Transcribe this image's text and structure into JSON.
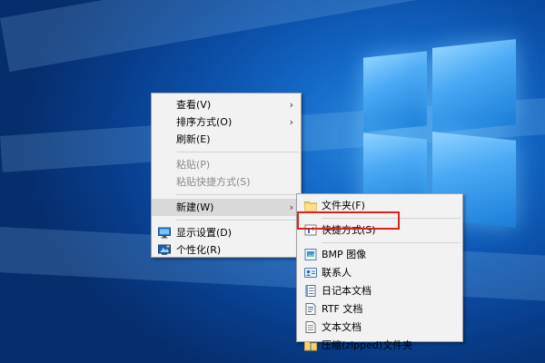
{
  "desktop": {
    "background": "Windows 10 hero wallpaper"
  },
  "context_menu": {
    "items": [
      {
        "label": "查看(V)",
        "submenu": true,
        "enabled": true
      },
      {
        "label": "排序方式(O)",
        "submenu": true,
        "enabled": true
      },
      {
        "label": "刷新(E)",
        "submenu": false,
        "enabled": true
      },
      {
        "label": "粘贴(P)",
        "submenu": false,
        "enabled": false
      },
      {
        "label": "粘贴快捷方式(S)",
        "submenu": false,
        "enabled": false
      },
      {
        "label": "新建(W)",
        "submenu": true,
        "enabled": true,
        "highlighted": true
      },
      {
        "label": "显示设置(D)",
        "icon": "display-settings-icon",
        "enabled": true
      },
      {
        "label": "个性化(R)",
        "icon": "personalize-icon",
        "enabled": true
      }
    ],
    "arrow_glyph": "›"
  },
  "new_submenu": {
    "items": [
      {
        "label": "文件夹(F)",
        "icon": "folder-icon"
      },
      {
        "label": "快捷方式(S)",
        "icon": "shortcut-icon",
        "outlined": true
      },
      {
        "label": "BMP 图像",
        "icon": "bmp-image-icon"
      },
      {
        "label": "联系人",
        "icon": "contact-icon"
      },
      {
        "label": "日记本文档",
        "icon": "journal-document-icon"
      },
      {
        "label": "RTF 文档",
        "icon": "rtf-document-icon"
      },
      {
        "label": "文本文档",
        "icon": "text-document-icon"
      },
      {
        "label": "压缩(zipped)文件夹",
        "icon": "zip-folder-icon"
      }
    ]
  },
  "colors": {
    "highlight_outline": "#e02020",
    "menu_background": "#f2f2f2",
    "hover_background": "#dadada",
    "disabled_text": "#8a8a8a"
  }
}
